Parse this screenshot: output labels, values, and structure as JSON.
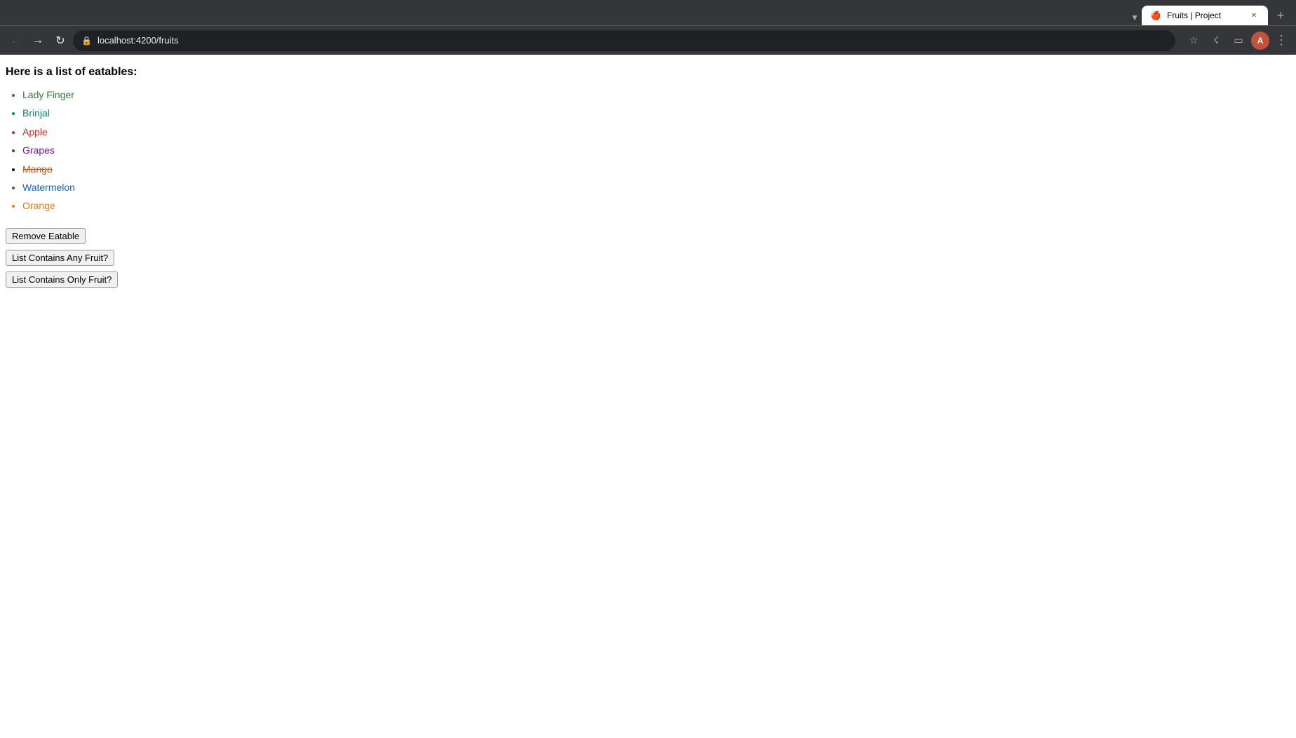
{
  "browser": {
    "tab": {
      "title": "Fruits | Project",
      "favicon": "🍎",
      "url": "localhost:4200/fruits"
    },
    "nav": {
      "back_disabled": false,
      "forward_disabled": true
    }
  },
  "page": {
    "heading": "Here is a list of eatables:",
    "eatables": [
      {
        "name": "Lady Finger",
        "color": "green",
        "strikethrough": false
      },
      {
        "name": "Brinjal",
        "color": "teal",
        "strikethrough": false
      },
      {
        "name": "Apple",
        "color": "red",
        "strikethrough": false
      },
      {
        "name": "Grapes",
        "color": "purple",
        "strikethrough": false
      },
      {
        "name": "Mango",
        "color": "orange-dark",
        "strikethrough": true
      },
      {
        "name": "Watermelon",
        "color": "blue",
        "strikethrough": false
      },
      {
        "name": "Orange",
        "color": "orange",
        "strikethrough": false
      }
    ],
    "buttons": {
      "remove_eatable": "Remove Eatable",
      "list_contains_any": "List Contains Any Fruit?",
      "list_contains_only": "List Contains Only Fruit?"
    }
  }
}
